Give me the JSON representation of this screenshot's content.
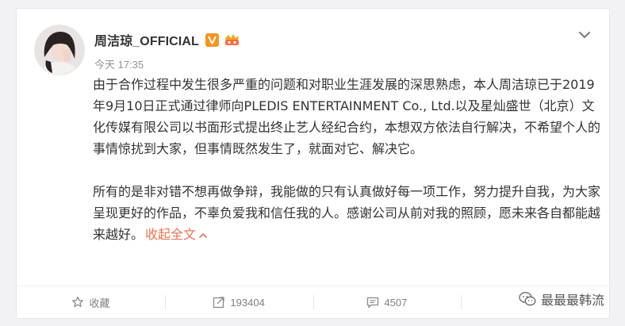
{
  "author": {
    "name": "周洁琼_OFFICIAL",
    "verified_badge": "V",
    "avatar_icon": "avatar-photo"
  },
  "post": {
    "time": "今天 17:35",
    "paragraph1": "由于合作过程中发生很多严重的问题和对职业生涯发展的深思熟虑，本人周洁琼已于2019年9月10日正式通过律师向PLEDIS ENTERTAINMENT Co., Ltd.以及星灿盛世（北京）文化传媒有限公司以书面形式提出终止艺人经纪合约，本想双方依法自行解决，不希望个人的事情惊扰到大家，但事情既然发生了，就面对它、解决它。",
    "paragraph2": "所有的是非对错不想再做争辩，我能做的只有认真做好每一项工作，努力提升自我，为大家呈现更好的作品，不辜负爱我和信任我的人。感谢公司从前对我的照顾，愿未来各自都能越来越好。",
    "collapse_label": "收起全文"
  },
  "footer": {
    "favorite_label": "收藏",
    "repost_count": "193404",
    "comment_count": "4507"
  },
  "watermark": {
    "text": "最最最韩流",
    "icon": "wechat-icon"
  },
  "colors": {
    "accent_link": "#eb7350",
    "vip_orange": "#f7941d",
    "muted_text": "#808080"
  }
}
